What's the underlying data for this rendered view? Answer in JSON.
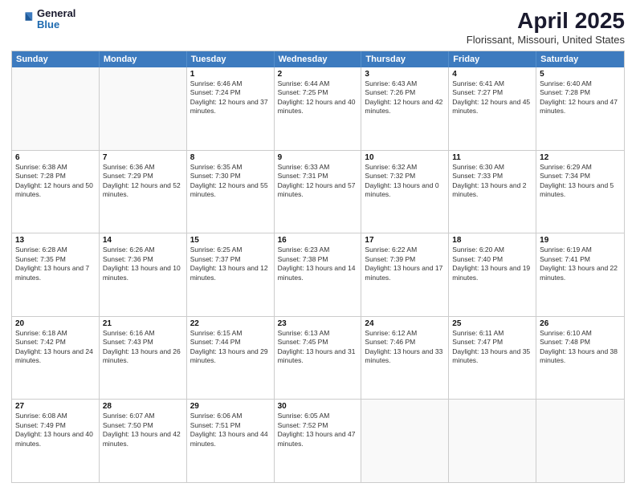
{
  "header": {
    "logo": {
      "general": "General",
      "blue": "Blue"
    },
    "title": "April 2025",
    "location": "Florissant, Missouri, United States"
  },
  "weekdays": [
    "Sunday",
    "Monday",
    "Tuesday",
    "Wednesday",
    "Thursday",
    "Friday",
    "Saturday"
  ],
  "weeks": [
    [
      {
        "day": "",
        "info": ""
      },
      {
        "day": "",
        "info": ""
      },
      {
        "day": "1",
        "info": "Sunrise: 6:46 AM\nSunset: 7:24 PM\nDaylight: 12 hours and 37 minutes."
      },
      {
        "day": "2",
        "info": "Sunrise: 6:44 AM\nSunset: 7:25 PM\nDaylight: 12 hours and 40 minutes."
      },
      {
        "day": "3",
        "info": "Sunrise: 6:43 AM\nSunset: 7:26 PM\nDaylight: 12 hours and 42 minutes."
      },
      {
        "day": "4",
        "info": "Sunrise: 6:41 AM\nSunset: 7:27 PM\nDaylight: 12 hours and 45 minutes."
      },
      {
        "day": "5",
        "info": "Sunrise: 6:40 AM\nSunset: 7:28 PM\nDaylight: 12 hours and 47 minutes."
      }
    ],
    [
      {
        "day": "6",
        "info": "Sunrise: 6:38 AM\nSunset: 7:28 PM\nDaylight: 12 hours and 50 minutes."
      },
      {
        "day": "7",
        "info": "Sunrise: 6:36 AM\nSunset: 7:29 PM\nDaylight: 12 hours and 52 minutes."
      },
      {
        "day": "8",
        "info": "Sunrise: 6:35 AM\nSunset: 7:30 PM\nDaylight: 12 hours and 55 minutes."
      },
      {
        "day": "9",
        "info": "Sunrise: 6:33 AM\nSunset: 7:31 PM\nDaylight: 12 hours and 57 minutes."
      },
      {
        "day": "10",
        "info": "Sunrise: 6:32 AM\nSunset: 7:32 PM\nDaylight: 13 hours and 0 minutes."
      },
      {
        "day": "11",
        "info": "Sunrise: 6:30 AM\nSunset: 7:33 PM\nDaylight: 13 hours and 2 minutes."
      },
      {
        "day": "12",
        "info": "Sunrise: 6:29 AM\nSunset: 7:34 PM\nDaylight: 13 hours and 5 minutes."
      }
    ],
    [
      {
        "day": "13",
        "info": "Sunrise: 6:28 AM\nSunset: 7:35 PM\nDaylight: 13 hours and 7 minutes."
      },
      {
        "day": "14",
        "info": "Sunrise: 6:26 AM\nSunset: 7:36 PM\nDaylight: 13 hours and 10 minutes."
      },
      {
        "day": "15",
        "info": "Sunrise: 6:25 AM\nSunset: 7:37 PM\nDaylight: 13 hours and 12 minutes."
      },
      {
        "day": "16",
        "info": "Sunrise: 6:23 AM\nSunset: 7:38 PM\nDaylight: 13 hours and 14 minutes."
      },
      {
        "day": "17",
        "info": "Sunrise: 6:22 AM\nSunset: 7:39 PM\nDaylight: 13 hours and 17 minutes."
      },
      {
        "day": "18",
        "info": "Sunrise: 6:20 AM\nSunset: 7:40 PM\nDaylight: 13 hours and 19 minutes."
      },
      {
        "day": "19",
        "info": "Sunrise: 6:19 AM\nSunset: 7:41 PM\nDaylight: 13 hours and 22 minutes."
      }
    ],
    [
      {
        "day": "20",
        "info": "Sunrise: 6:18 AM\nSunset: 7:42 PM\nDaylight: 13 hours and 24 minutes."
      },
      {
        "day": "21",
        "info": "Sunrise: 6:16 AM\nSunset: 7:43 PM\nDaylight: 13 hours and 26 minutes."
      },
      {
        "day": "22",
        "info": "Sunrise: 6:15 AM\nSunset: 7:44 PM\nDaylight: 13 hours and 29 minutes."
      },
      {
        "day": "23",
        "info": "Sunrise: 6:13 AM\nSunset: 7:45 PM\nDaylight: 13 hours and 31 minutes."
      },
      {
        "day": "24",
        "info": "Sunrise: 6:12 AM\nSunset: 7:46 PM\nDaylight: 13 hours and 33 minutes."
      },
      {
        "day": "25",
        "info": "Sunrise: 6:11 AM\nSunset: 7:47 PM\nDaylight: 13 hours and 35 minutes."
      },
      {
        "day": "26",
        "info": "Sunrise: 6:10 AM\nSunset: 7:48 PM\nDaylight: 13 hours and 38 minutes."
      }
    ],
    [
      {
        "day": "27",
        "info": "Sunrise: 6:08 AM\nSunset: 7:49 PM\nDaylight: 13 hours and 40 minutes."
      },
      {
        "day": "28",
        "info": "Sunrise: 6:07 AM\nSunset: 7:50 PM\nDaylight: 13 hours and 42 minutes."
      },
      {
        "day": "29",
        "info": "Sunrise: 6:06 AM\nSunset: 7:51 PM\nDaylight: 13 hours and 44 minutes."
      },
      {
        "day": "30",
        "info": "Sunrise: 6:05 AM\nSunset: 7:52 PM\nDaylight: 13 hours and 47 minutes."
      },
      {
        "day": "",
        "info": ""
      },
      {
        "day": "",
        "info": ""
      },
      {
        "day": "",
        "info": ""
      }
    ]
  ]
}
